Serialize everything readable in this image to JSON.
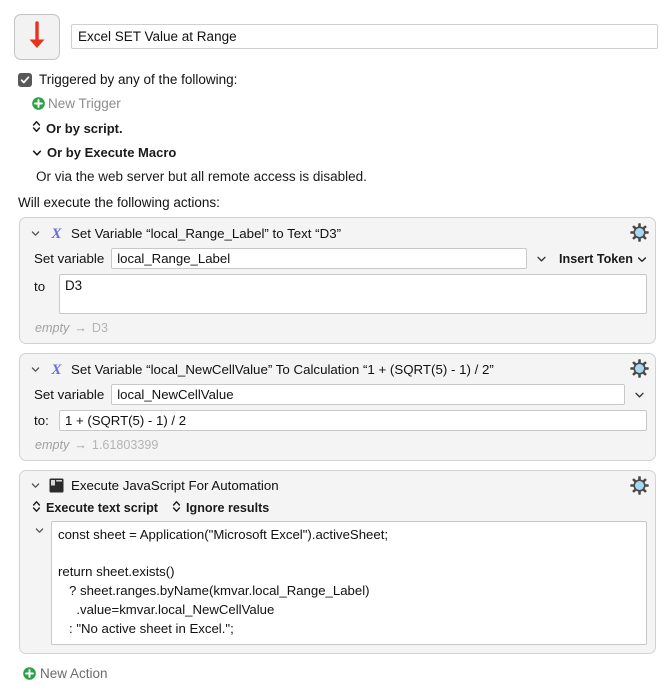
{
  "window": {
    "macro_icon": "red-down-arrow-icon",
    "macro_title": "Excel SET Value at Range"
  },
  "triggers": {
    "checkbox_checked": true,
    "checkbox_label": "Triggered by any of the following:",
    "new_trigger_label": "New Trigger",
    "or_by_script_label": "Or by script.",
    "or_by_execute_macro_label": "Or by Execute Macro",
    "web_server_note": "Or via the web server but all remote access is disabled."
  },
  "actions_header": "Will execute the following actions:",
  "actions": [
    {
      "icon": "variable-x-icon",
      "title": "Set Variable “local_Range_Label” to Text “D3”",
      "variable_label": "Set variable",
      "variable_value": "local_Range_Label",
      "insert_token_label": "Insert Token",
      "to_label": "to",
      "to_value": "D3",
      "result_empty": "empty",
      "result_arrow": "→",
      "result_value": "D3"
    },
    {
      "icon": "variable-x-icon",
      "title": "Set Variable “local_NewCellValue” To Calculation “1 + (SQRT(5) - 1) / 2”",
      "variable_label": "Set variable",
      "variable_value": "local_NewCellValue",
      "to_label": "to:",
      "to_value": "1 + (SQRT(5) - 1) / 2",
      "result_empty": "empty",
      "result_arrow": "→",
      "result_value": "1.61803399"
    },
    {
      "icon": "script-terminal-icon",
      "title": "Execute JavaScript For Automation",
      "popup_execute_label": "Execute text script",
      "popup_results_label": "Ignore results",
      "script": "const sheet = Application(\"Microsoft Excel\").activeSheet;\n\nreturn sheet.exists()\n   ? sheet.ranges.byName(kmvar.local_Range_Label)\n     .value=kmvar.local_NewCellValue\n   : \"No active sheet in Excel.\";"
    }
  ],
  "new_action_label": "New Action",
  "colors": {
    "accent_red": "#e8321e",
    "variable_icon_blue": "#6b6be0",
    "plus_green": "#2fa04a",
    "gear_blue": "#a8d8f0",
    "action_bg": "#f4f4f4",
    "action_border": "#d2d2d2"
  }
}
